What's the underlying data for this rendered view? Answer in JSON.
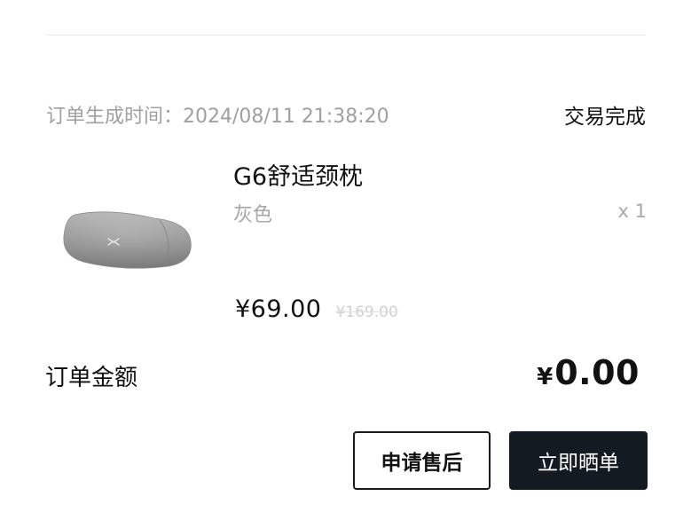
{
  "order": {
    "time_label": "订单生成时间：",
    "time_value": "2024/08/11 21:38:20",
    "status": "交易完成"
  },
  "product": {
    "name": "G6舒适颈枕",
    "variant": "灰色",
    "quantity": "x 1",
    "price": "¥69.00",
    "original_price": "¥169.00",
    "image_icon": "neck-pillow-image",
    "logo_icon": "x-logo-icon"
  },
  "summary": {
    "total_label": "订单金额",
    "currency": "¥",
    "total_value": "0.00"
  },
  "actions": {
    "after_sale_label": "申请售后",
    "share_label": "立即晒单"
  },
  "colors": {
    "primary_button_bg": "#141a22",
    "muted_text": "#a0a0a0",
    "divider": "#e8e8e8"
  }
}
